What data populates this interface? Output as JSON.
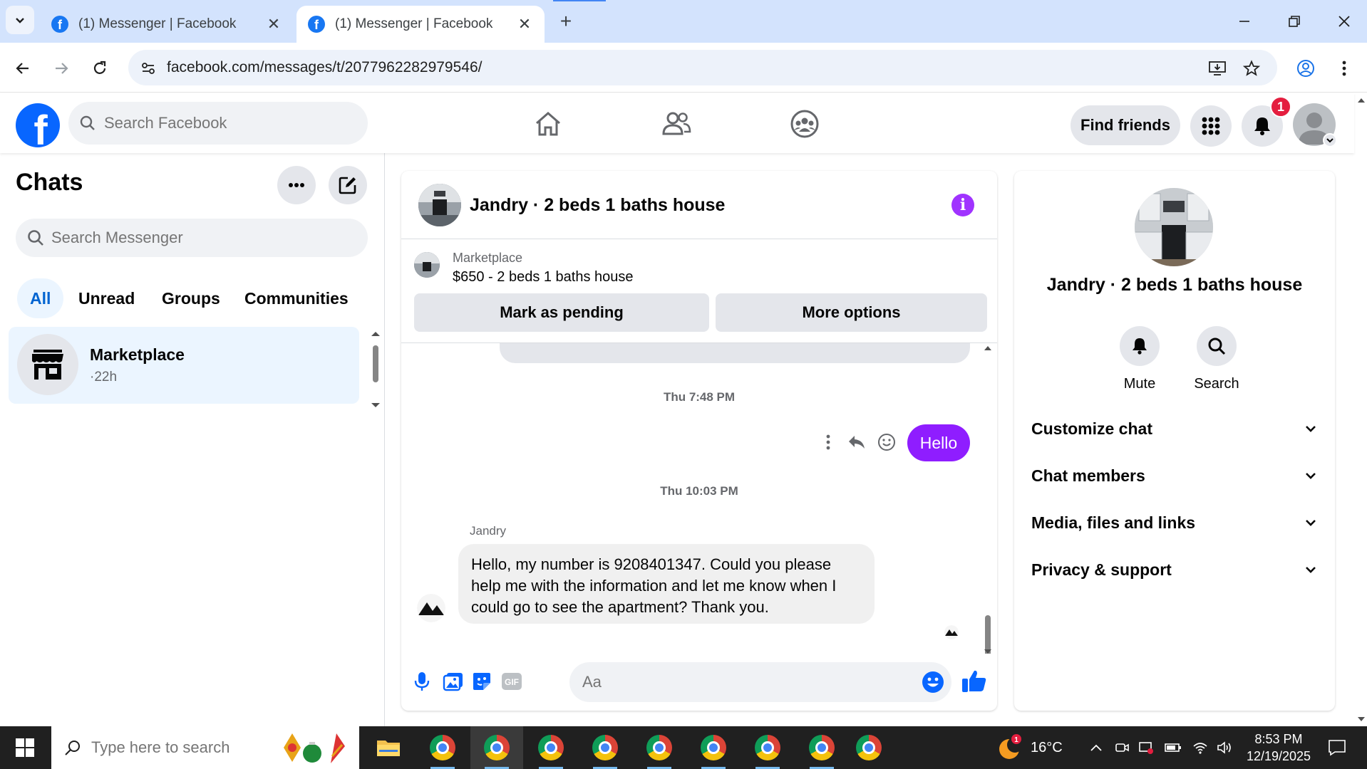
{
  "browser": {
    "tabs": [
      {
        "title": "(1) Messenger | Facebook"
      },
      {
        "title": "(1) Messenger | Facebook"
      }
    ],
    "url": "facebook.com/messages/t/2077962282979546/"
  },
  "header": {
    "search_placeholder": "Search Facebook",
    "find_friends_label": "Find friends",
    "notification_count": "1"
  },
  "chats": {
    "title": "Chats",
    "search_placeholder": "Search Messenger",
    "filters": [
      "All",
      "Unread",
      "Groups",
      "Communities"
    ],
    "items": [
      {
        "name": "Marketplace",
        "time": "·22h"
      }
    ]
  },
  "conversation": {
    "title": "Jandry · 2 beds 1 baths house",
    "marketplace_label": "Marketplace",
    "listing": "$650 - 2 beds 1 baths house",
    "mark_pending_label": "Mark as pending",
    "more_options_label": "More options",
    "messages": [
      {
        "timestamp": "Thu 7:48 PM",
        "text": "Hello"
      },
      {
        "timestamp": "Thu 10:03 PM",
        "sender": "Jandry",
        "text": "Hello, my number is 9208401347. Could you please help me with the information and let me know when I could go to see the apartment? Thank you."
      }
    ],
    "composer_placeholder": "Aa"
  },
  "details": {
    "title": "Jandry · 2 beds 1 baths house",
    "actions": [
      "Mute",
      "Search"
    ],
    "sections": [
      "Customize chat",
      "Chat members",
      "Media, files and links",
      "Privacy & support"
    ]
  },
  "taskbar": {
    "search_placeholder": "Type here to search",
    "temperature": "16°C",
    "weather_badge": "1",
    "time": "8:53 PM",
    "date": "12/19/2025"
  },
  "colors": {
    "facebook_blue": "#0866ff",
    "messenger_purple": "#8f1dff",
    "active_filter_bg": "#ebf5ff",
    "tabstrip_bg": "#d3e3fd"
  }
}
